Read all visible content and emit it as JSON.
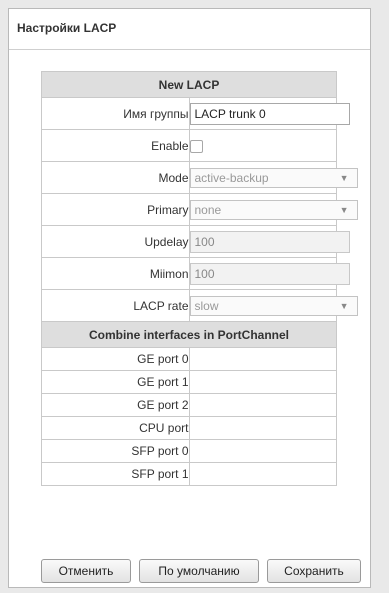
{
  "window": {
    "title": "Настройки LACP"
  },
  "form": {
    "header": "New LACP",
    "group_name": {
      "label": "Имя группы",
      "value": "LACP trunk 0"
    },
    "enable": {
      "label": "Enable",
      "checked": false
    },
    "mode": {
      "label": "Mode",
      "value": "active-backup"
    },
    "primary": {
      "label": "Primary",
      "value": "none"
    },
    "updelay": {
      "label": "Updelay",
      "value": "100"
    },
    "miimon": {
      "label": "Miimon",
      "value": "100"
    },
    "lacp_rate": {
      "label": "LACP rate",
      "value": "slow"
    }
  },
  "ports_section": {
    "header": "Combine interfaces in PortChannel",
    "ports": [
      "GE port 0",
      "GE port 1",
      "GE port 2",
      "CPU port",
      "SFP port 0",
      "SFP port 1"
    ]
  },
  "buttons": {
    "cancel": "Отменить",
    "default": "По умолчанию",
    "save": "Сохранить"
  }
}
